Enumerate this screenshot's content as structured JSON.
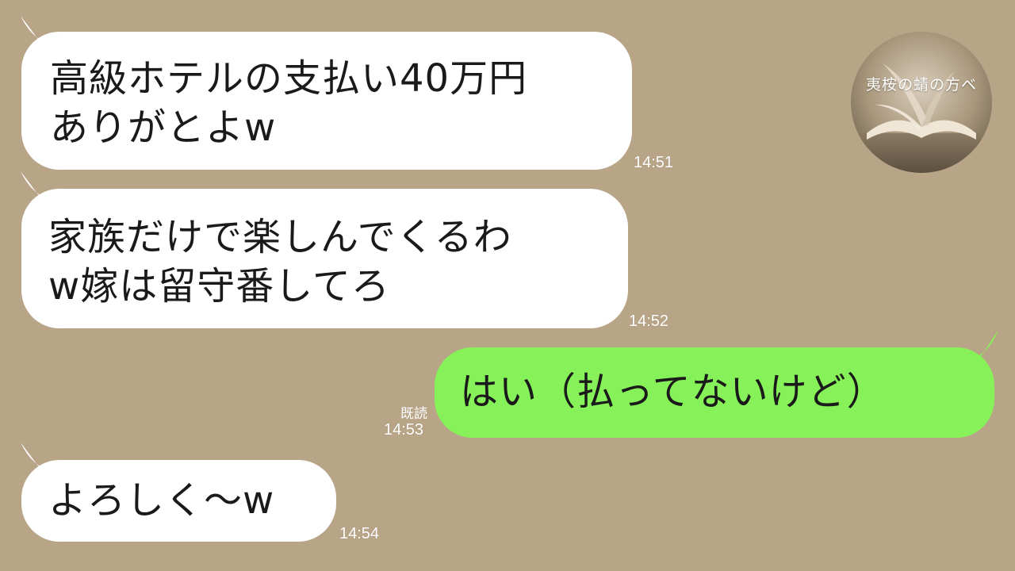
{
  "messages": [
    {
      "sender": "other",
      "lines": [
        "高級ホテルの支払い40万円",
        "ありがとよw"
      ],
      "time": "14:51"
    },
    {
      "sender": "other",
      "lines": [
        "家族だけで楽しんでくるわ",
        "w嫁は留守番してろ"
      ],
      "time": "14:52"
    },
    {
      "sender": "me",
      "lines": [
        "はい（払ってないけど）"
      ],
      "time": "14:53",
      "read_label": "既読"
    },
    {
      "sender": "other",
      "lines": [
        "よろしく～w"
      ],
      "time": "14:54"
    }
  ],
  "logo": {
    "text": "夷桉の蜻の方ベ",
    "icon": "open-book-logo"
  },
  "colors": {
    "background": "#b8a487",
    "other_bubble": "#ffffff",
    "my_bubble": "#86f158"
  }
}
